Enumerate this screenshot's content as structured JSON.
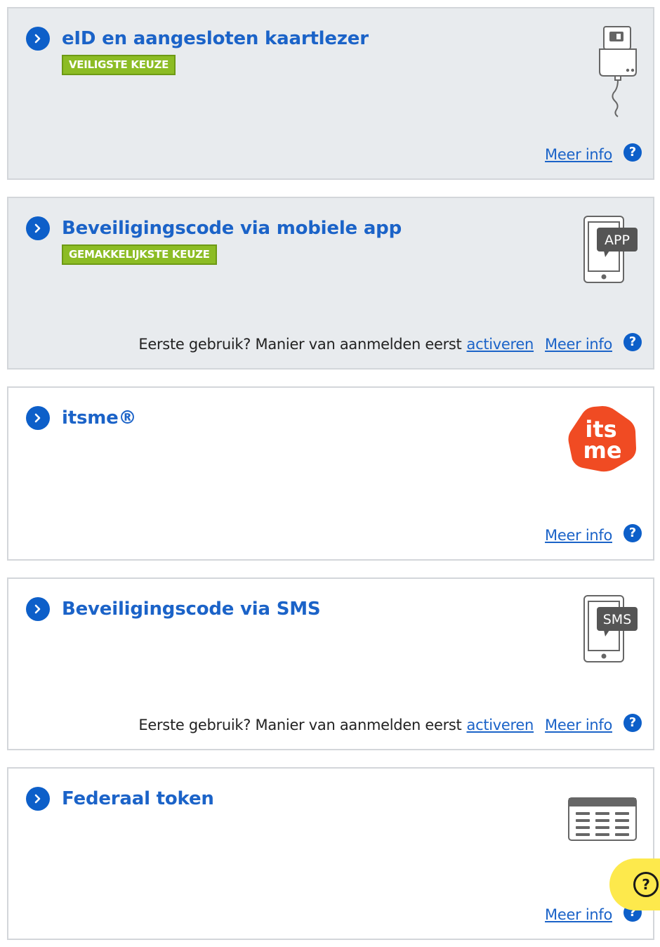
{
  "colors": {
    "accent": "#1b63c8",
    "badge_green": "#8cbc24",
    "card_grey": "#e8ebee",
    "itsme_orange": "#f04b23",
    "help_yellow": "#fde94c"
  },
  "cards": [
    {
      "title": "eID en aangesloten kaartlezer",
      "badge": "VEILIGSTE KEUZE",
      "illustration": "card-reader-icon",
      "more_info": "Meer info",
      "help": "?"
    },
    {
      "title": "Beveiligingscode via mobiele app",
      "badge": "GEMAKKELIJKSTE KEUZE",
      "illustration": "phone-app-icon",
      "illustration_label": "APP",
      "first_use": "Eerste gebruik? Manier van aanmelden eerst",
      "activate": "activeren",
      "more_info": "Meer info",
      "help": "?"
    },
    {
      "title": "itsme®",
      "illustration": "itsme-logo",
      "logo_text_top": "its",
      "logo_text_bottom": "me",
      "more_info": "Meer info",
      "help": "?"
    },
    {
      "title": "Beveiligingscode via SMS",
      "illustration": "phone-sms-icon",
      "illustration_label": "SMS",
      "first_use": "Eerste gebruik? Manier van aanmelden eerst",
      "activate": "activeren",
      "more_info": "Meer info",
      "help": "?"
    },
    {
      "title": "Federaal token",
      "illustration": "token-card-icon",
      "more_info": "Meer info",
      "help": "?"
    }
  ],
  "help_widget": {
    "label": "?"
  }
}
